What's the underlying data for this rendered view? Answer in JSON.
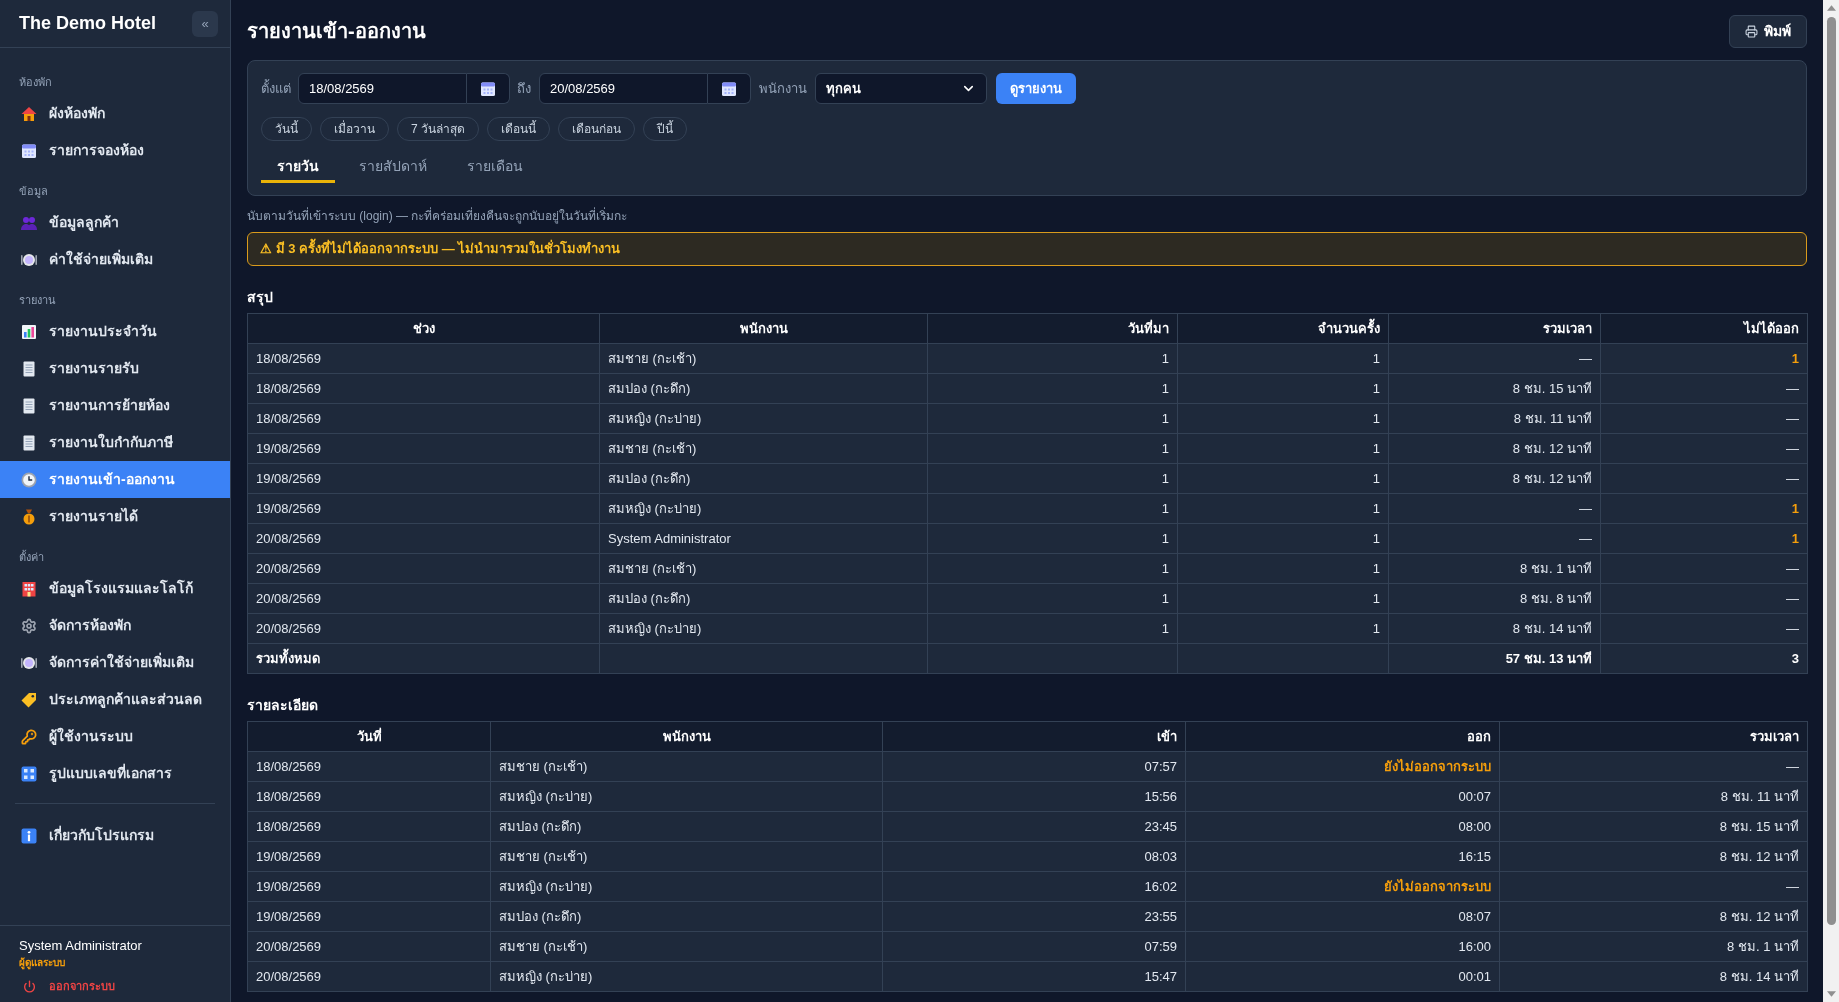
{
  "sidebar": {
    "brand": "The Demo Hotel",
    "collapse_button": "«",
    "sections": [
      {
        "label": "ห้องพัก",
        "items": [
          {
            "label": "ผังห้องพัก",
            "selected": false
          },
          {
            "label": "รายการจองห้อง",
            "selected": false
          }
        ]
      },
      {
        "label": "ข้อมูล",
        "items": [
          {
            "label": "ข้อมูลลูกค้า",
            "selected": false
          },
          {
            "label": "ค่าใช้จ่ายเพิ่มเติม",
            "selected": false
          }
        ]
      },
      {
        "label": "รายงาน",
        "items": [
          {
            "label": "รายงานประจำวัน",
            "selected": false
          },
          {
            "label": "รายงานรายรับ",
            "selected": false
          },
          {
            "label": "รายงานการย้ายห้อง",
            "selected": false
          },
          {
            "label": "รายงานใบกำกับภาษี",
            "selected": false
          },
          {
            "label": "รายงานเข้า-ออกงาน",
            "selected": true
          },
          {
            "label": "รายงานรายได้",
            "selected": false
          }
        ]
      },
      {
        "label": "ตั้งค่า",
        "items": [
          {
            "label": "ข้อมูลโรงแรมและโลโก้",
            "selected": false
          },
          {
            "label": "จัดการห้องพัก",
            "selected": false
          },
          {
            "label": "จัดการค่าใช้จ่ายเพิ่มเติม",
            "selected": false
          },
          {
            "label": "ประเภทลูกค้าและส่วนลด",
            "selected": false
          },
          {
            "label": "ผู้ใช้งานระบบ",
            "selected": false
          },
          {
            "label": "รูปแบบเลขที่เอกสาร",
            "selected": false
          }
        ]
      }
    ],
    "bottom_items": [
      {
        "label": "เกี่ยวกับโปรแกรม",
        "selected": false
      }
    ],
    "user": {
      "name": "System Administrator",
      "role": "ผู้ดูแลระบบ",
      "logout": "ออกจากระบบ"
    }
  },
  "page": {
    "title": "รายงานเข้า-ออกงาน",
    "print_button": "พิมพ์"
  },
  "filters": {
    "from_label": "ตั้งแต่",
    "from_date": "18/08/2569",
    "to_label": "ถึง",
    "to_date": "20/08/2569",
    "employee_label": "พนักงาน",
    "employee": "ทุกคน",
    "submit_button": "ดูรายงาน",
    "quick_ranges": [
      "วันนี้",
      "เมื่อวาน",
      "7 วันล่าสุด",
      "เดือนนี้",
      "เดือนก่อน",
      "ปีนี้"
    ],
    "tabs": [
      {
        "label": "รายวัน",
        "selected": true
      },
      {
        "label": "รายสัปดาห์",
        "selected": false
      },
      {
        "label": "รายเดือน",
        "selected": false
      }
    ]
  },
  "note": "นับตามวันที่เข้าระบบ (login) — กะที่คร่อมเที่ยงคืนจะถูกนับอยู่ในวันที่เริ่มกะ",
  "warning": "⚠ มี 3 ครั้งที่ไม่ได้ออกจากระบบ — ไม่นำมารวมในชั่วโมงทำงาน",
  "summary": {
    "title": "สรุป",
    "columns": [
      "ช่วง",
      "พนักงาน",
      "วันที่มา",
      "จำนวนครั้ง",
      "รวมเวลา",
      "ไม่ได้ออก"
    ],
    "rows": [
      {
        "period": "18/08/2569",
        "employee": "สมชาย (กะเช้า)",
        "days": "1",
        "count": "1",
        "total_time": "—",
        "not_logged_out": "1",
        "flagged": true
      },
      {
        "period": "18/08/2569",
        "employee": "สมปอง (กะดึก)",
        "days": "1",
        "count": "1",
        "total_time": "8 ชม. 15 นาที",
        "not_logged_out": "—",
        "flagged": false
      },
      {
        "period": "18/08/2569",
        "employee": "สมหญิง (กะบ่าย)",
        "days": "1",
        "count": "1",
        "total_time": "8 ชม. 11 นาที",
        "not_logged_out": "—",
        "flagged": false
      },
      {
        "period": "19/08/2569",
        "employee": "สมชาย (กะเช้า)",
        "days": "1",
        "count": "1",
        "total_time": "8 ชม. 12 นาที",
        "not_logged_out": "—",
        "flagged": false
      },
      {
        "period": "19/08/2569",
        "employee": "สมปอง (กะดึก)",
        "days": "1",
        "count": "1",
        "total_time": "8 ชม. 12 นาที",
        "not_logged_out": "—",
        "flagged": false
      },
      {
        "period": "19/08/2569",
        "employee": "สมหญิง (กะบ่าย)",
        "days": "1",
        "count": "1",
        "total_time": "—",
        "not_logged_out": "1",
        "flagged": true
      },
      {
        "period": "20/08/2569",
        "employee": "System Administrator",
        "days": "1",
        "count": "1",
        "total_time": "—",
        "not_logged_out": "1",
        "flagged": true
      },
      {
        "period": "20/08/2569",
        "employee": "สมชาย (กะเช้า)",
        "days": "1",
        "count": "1",
        "total_time": "8 ชม. 1 นาที",
        "not_logged_out": "—",
        "flagged": false
      },
      {
        "period": "20/08/2569",
        "employee": "สมปอง (กะดึก)",
        "days": "1",
        "count": "1",
        "total_time": "8 ชม. 8 นาที",
        "not_logged_out": "—",
        "flagged": false
      },
      {
        "period": "20/08/2569",
        "employee": "สมหญิง (กะบ่าย)",
        "days": "1",
        "count": "1",
        "total_time": "8 ชม. 14 นาที",
        "not_logged_out": "—",
        "flagged": false
      }
    ],
    "total": {
      "label": "รวมทั้งหมด",
      "total_time": "57 ชม. 13 นาที",
      "not_logged_out": "3"
    }
  },
  "details": {
    "title": "รายละเอียด",
    "columns": [
      "วันที่",
      "พนักงาน",
      "เข้า",
      "ออก",
      "รวมเวลา"
    ],
    "rows": [
      {
        "date": "18/08/2569",
        "employee": "สมชาย (กะเช้า)",
        "time_in": "07:57",
        "time_out": "ยังไม่ออกจากระบบ",
        "missing_logout": true,
        "total_time": "—"
      },
      {
        "date": "18/08/2569",
        "employee": "สมหญิง (กะบ่าย)",
        "time_in": "15:56",
        "time_out": "00:07",
        "missing_logout": false,
        "total_time": "8 ชม. 11 นาที"
      },
      {
        "date": "18/08/2569",
        "employee": "สมปอง (กะดึก)",
        "time_in": "23:45",
        "time_out": "08:00",
        "missing_logout": false,
        "total_time": "8 ชม. 15 นาที"
      },
      {
        "date": "19/08/2569",
        "employee": "สมชาย (กะเช้า)",
        "time_in": "08:03",
        "time_out": "16:15",
        "missing_logout": false,
        "total_time": "8 ชม. 12 นาที"
      },
      {
        "date": "19/08/2569",
        "employee": "สมหญิง (กะบ่าย)",
        "time_in": "16:02",
        "time_out": "ยังไม่ออกจากระบบ",
        "missing_logout": true,
        "total_time": "—"
      },
      {
        "date": "19/08/2569",
        "employee": "สมปอง (กะดึก)",
        "time_in": "23:55",
        "time_out": "08:07",
        "missing_logout": false,
        "total_time": "8 ชม. 12 นาที"
      },
      {
        "date": "20/08/2569",
        "employee": "สมชาย (กะเช้า)",
        "time_in": "07:59",
        "time_out": "16:00",
        "missing_logout": false,
        "total_time": "8 ชม. 1 นาที"
      },
      {
        "date": "20/08/2569",
        "employee": "สมหญิง (กะบ่าย)",
        "time_in": "15:47",
        "time_out": "00:01",
        "missing_logout": false,
        "total_time": "8 ชม. 14 นาที"
      }
    ]
  }
}
